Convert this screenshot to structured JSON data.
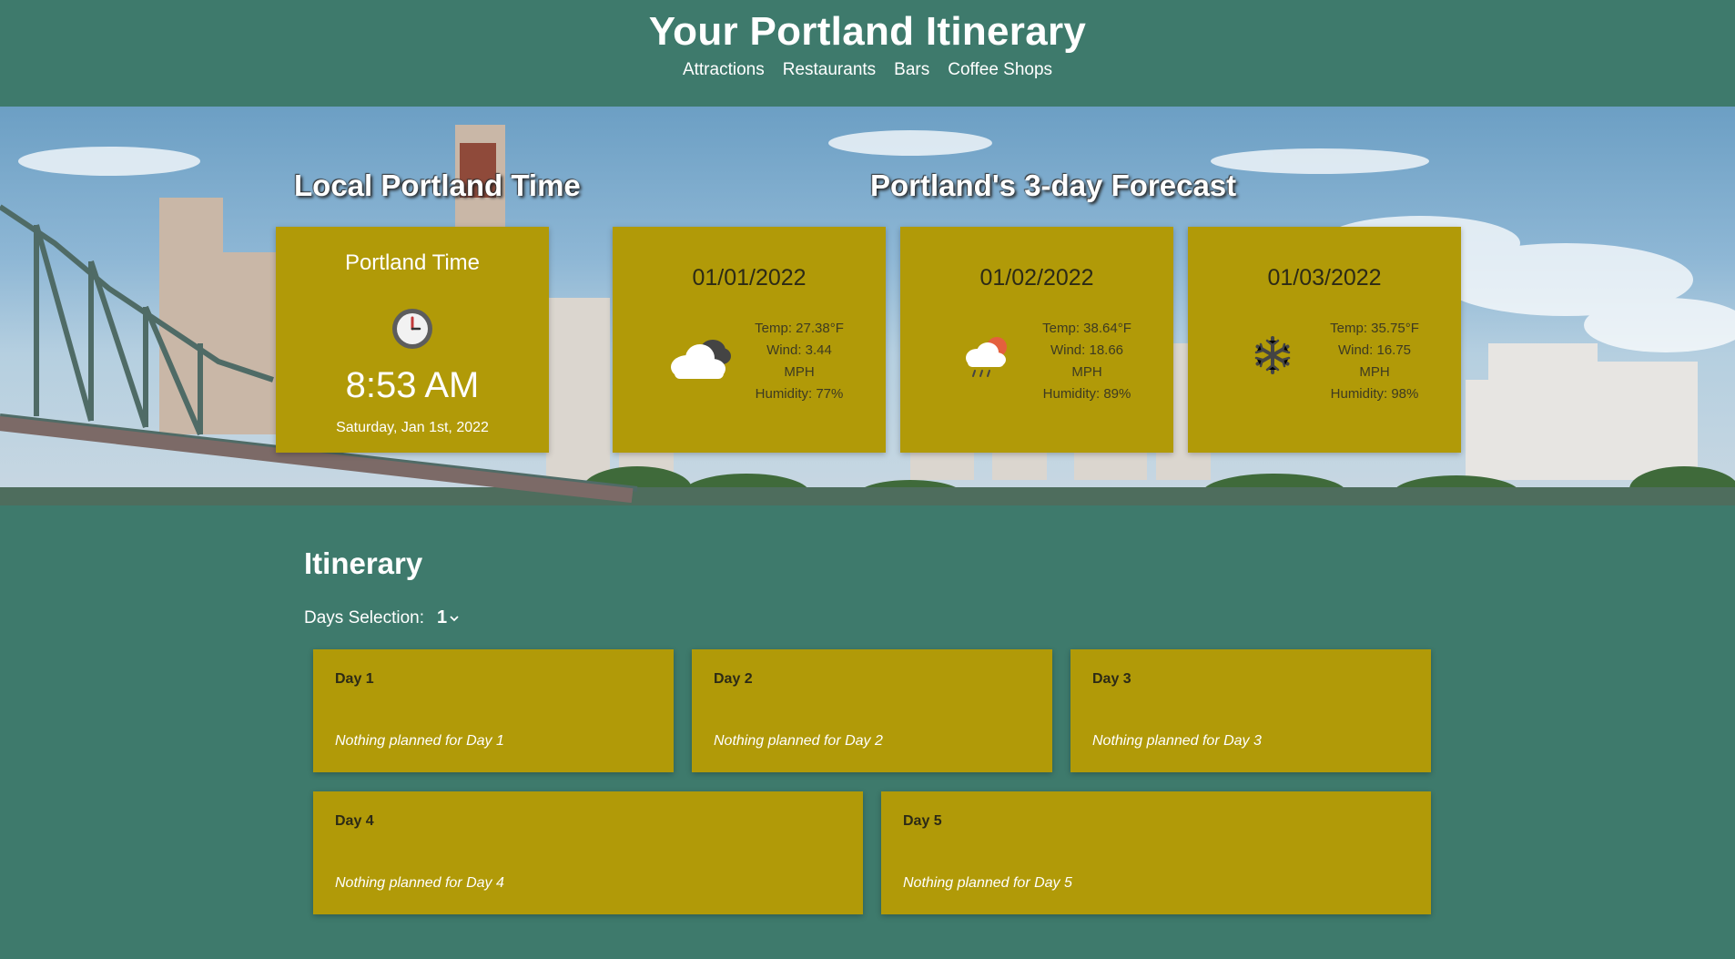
{
  "header": {
    "title": "Your Portland Itinerary",
    "nav": [
      "Attractions",
      "Restaurants",
      "Bars",
      "Coffee Shops"
    ]
  },
  "hero": {
    "time_heading": "Local Portland Time",
    "forecast_heading": "Portland's 3-day Forecast",
    "time_card": {
      "title": "Portland Time",
      "time": "8:53 AM",
      "date": "Saturday, Jan 1st, 2022",
      "icon": "clock-icon"
    },
    "forecast": [
      {
        "date": "01/01/2022",
        "icon": "cloudy-icon",
        "temp": "Temp: 27.38°F",
        "wind": "Wind: 3.44",
        "wind_unit": "MPH",
        "humidity": "Humidity: 77%"
      },
      {
        "date": "01/02/2022",
        "icon": "rain-sun-icon",
        "temp": "Temp: 38.64°F",
        "wind": "Wind: 18.66",
        "wind_unit": "MPH",
        "humidity": "Humidity: 89%"
      },
      {
        "date": "01/03/2022",
        "icon": "snowflake-icon",
        "temp": "Temp: 35.75°F",
        "wind": "Wind: 16.75",
        "wind_unit": "MPH",
        "humidity": "Humidity: 98%"
      }
    ]
  },
  "itinerary": {
    "heading": "Itinerary",
    "days_label": "Days Selection:",
    "days_value": "1",
    "days": [
      {
        "title": "Day 1",
        "note": "Nothing planned for Day 1"
      },
      {
        "title": "Day 2",
        "note": "Nothing planned for Day 2"
      },
      {
        "title": "Day 3",
        "note": "Nothing planned for Day 3"
      },
      {
        "title": "Day 4",
        "note": "Nothing planned for Day 4"
      },
      {
        "title": "Day 5",
        "note": "Nothing planned for Day 5"
      }
    ]
  },
  "colors": {
    "background": "#3e7a6c",
    "card": "#b19a08"
  }
}
